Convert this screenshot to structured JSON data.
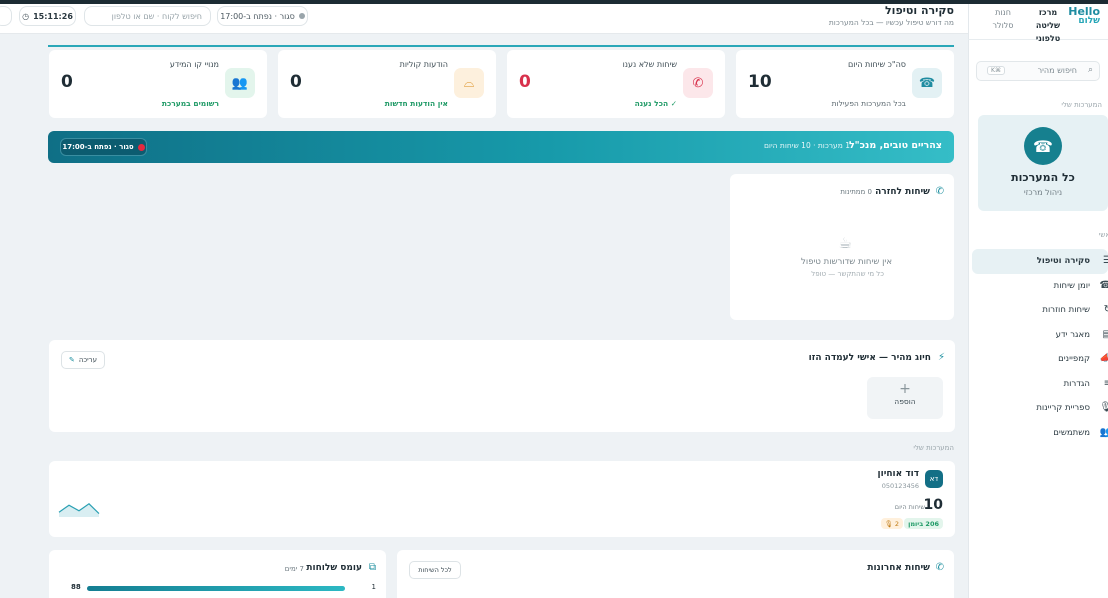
{
  "sidebar": {
    "logo_top": "Hello",
    "logo_bottom": "שלום",
    "nav_active_line1": "מרכז שליטה",
    "nav_active_line2": "טלפוני",
    "nav_inactive_line1": "חנות",
    "nav_inactive_line2": "סלולר",
    "search_placeholder": "חיפוש מהיר",
    "search_shortcut": "⌘K",
    "org_caption": "המערכות שלי",
    "org_name": "כל המערכות",
    "org_sub": "ניהול מרכזי",
    "menu_caption": "ראשי",
    "items": [
      {
        "label": "סקירה וטיפול",
        "icon": "☰",
        "active": true
      },
      {
        "label": "יומן שיחות",
        "icon": "☎"
      },
      {
        "label": "שיחות חוזרות",
        "icon": "↻"
      },
      {
        "label": "מאגר ידע",
        "icon": "▤"
      },
      {
        "label": "קמפיינים",
        "icon": "📣"
      },
      {
        "label": "הגדרות",
        "icon": "≡"
      },
      {
        "label": "ספריית קריינות",
        "icon": "🎙"
      },
      {
        "label": "משתמשים",
        "icon": "👥"
      }
    ]
  },
  "header": {
    "title": "סקירה וטיפול",
    "subtitle": "מה דורש טיפול עכשיו — בכל המערכות",
    "status": "סגור · נפתח ב-17:00",
    "search_placeholder": "חיפוש לקוח · שם או טלפון",
    "clock": "15:11:26"
  },
  "stats": [
    {
      "title": "סה\"כ שיחות היום",
      "value": "10",
      "footer": "בכל המערכות הפעילות",
      "icon": "☎",
      "color": "#1f8ca1",
      "bg": "#e3f1f4"
    },
    {
      "title": "שיחות שלא נענו",
      "value": "0",
      "footer": "✓ הכל נענה",
      "icon": "✆",
      "color": "#d8314c",
      "bg": "#fce7ea"
    },
    {
      "title": "הודעות קוליות",
      "value": "0",
      "footer": "אין הודעות חדשות",
      "icon": "⌓",
      "color": "#d98a17",
      "bg": "#fdf0dd"
    },
    {
      "title": "מנויי קו המידע",
      "value": "0",
      "footer": "רשומים במערכת",
      "icon": "👥",
      "color": "#1f9a66",
      "bg": "#e3f5ec"
    }
  ],
  "banner": {
    "greeting": "צהריים טובים, מנכ\"ל",
    "meta": "1 מערכות · 10 שיחות היום",
    "status": "סגור · נפתח ב-17:00"
  },
  "return_calls": {
    "title": "שיחות לחזרה",
    "count": "0 ממתינות",
    "empty_title": "אין שיחות שדורשות טיפול",
    "empty_sub": "כל מי שהתקשר — טופל"
  },
  "quick_dial": {
    "title": "חיוג מהיר — אישי לעמדה הזו",
    "edit": "עריכה",
    "add": "הוספה"
  },
  "systems_caption": "המערכות שלי",
  "agent": {
    "initials": "דא",
    "name": "דוד אוחיון",
    "phone": "050123456",
    "calls_today": "10",
    "calls_label": "שיחות היום",
    "badge_green": "206 ביומן",
    "badge_orange": "2",
    "spark": [
      0.2,
      0.7,
      0.3,
      0.8,
      0.1
    ]
  },
  "recent": {
    "title": "שיחות אחרונות",
    "all": "לכל השיחות"
  },
  "load": {
    "title": "עומס שלוחות",
    "days": "7 ימים",
    "row_label": "1",
    "row_value": "88",
    "row_fraction": 1.0
  }
}
